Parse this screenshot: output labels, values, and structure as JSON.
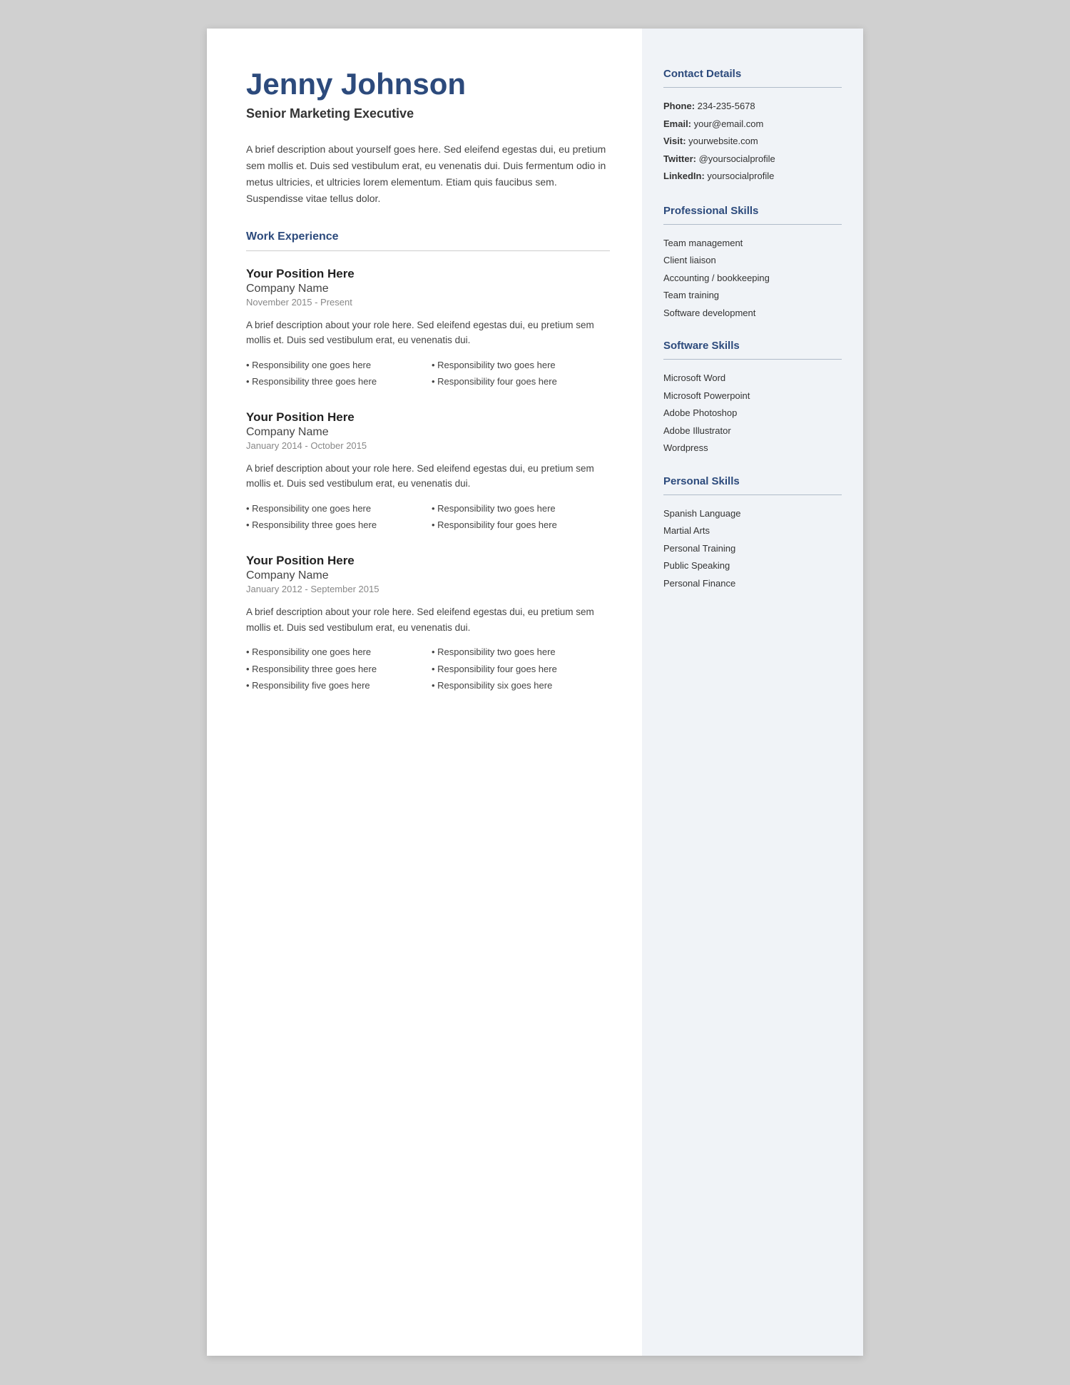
{
  "header": {
    "name": "Jenny Johnson",
    "title": "Senior Marketing Executive",
    "summary": "A brief description about yourself goes here. Sed eleifend egestas dui, eu pretium sem mollis et. Duis sed vestibulum erat, eu venenatis dui. Duis fermentum odio in metus ultricies, et ultricies lorem elementum. Etiam quis faucibus sem. Suspendisse vitae tellus dolor."
  },
  "work_experience": {
    "heading": "Work Experience",
    "jobs": [
      {
        "position": "Your Position Here",
        "company": "Company Name",
        "dates": "November 2015 - Present",
        "description": "A brief description about your role here. Sed eleifend egestas dui, eu pretium sem mollis et. Duis sed vestibulum erat, eu venenatis dui.",
        "responsibilities": [
          "Responsibility one goes here",
          "Responsibility two goes here",
          "Responsibility three goes here",
          "Responsibility four goes here"
        ]
      },
      {
        "position": "Your Position Here",
        "company": "Company Name",
        "dates": "January 2014 - October 2015",
        "description": "A brief description about your role here. Sed eleifend egestas dui, eu pretium sem mollis et. Duis sed vestibulum erat, eu venenatis dui.",
        "responsibilities": [
          "Responsibility one goes here",
          "Responsibility two goes here",
          "Responsibility three goes here",
          "Responsibility four goes here"
        ]
      },
      {
        "position": "Your Position Here",
        "company": "Company Name",
        "dates": "January 2012 - September 2015",
        "description": "A brief description about your role here. Sed eleifend egestas dui, eu pretium sem mollis et. Duis sed vestibulum erat, eu venenatis dui.",
        "responsibilities": [
          "Responsibility one goes here",
          "Responsibility two goes here",
          "Responsibility three goes here",
          "Responsibility four goes here",
          "Responsibility five goes here",
          "Responsibility six goes here"
        ]
      }
    ]
  },
  "contact": {
    "heading": "Contact Details",
    "items": [
      {
        "label": "Phone:",
        "value": "234-235-5678"
      },
      {
        "label": "Email:",
        "value": "your@email.com"
      },
      {
        "label": "Visit:",
        "value": "yourwebsite.com"
      },
      {
        "label": "Twitter:",
        "value": "@yoursocialprofile"
      },
      {
        "label": "LinkedIn:",
        "value": "yoursocialprofile"
      }
    ]
  },
  "professional_skills": {
    "heading": "Professional Skills",
    "items": [
      "Team management",
      "Client liaison",
      "Accounting / bookkeeping",
      "Team training",
      "Software development"
    ]
  },
  "software_skills": {
    "heading": "Software Skills",
    "items": [
      "Microsoft Word",
      "Microsoft Powerpoint",
      "Adobe Photoshop",
      "Adobe Illustrator",
      "Wordpress"
    ]
  },
  "personal_skills": {
    "heading": "Personal Skills",
    "items": [
      "Spanish Language",
      "Martial Arts",
      "Personal Training",
      "Public Speaking",
      "Personal Finance"
    ]
  }
}
